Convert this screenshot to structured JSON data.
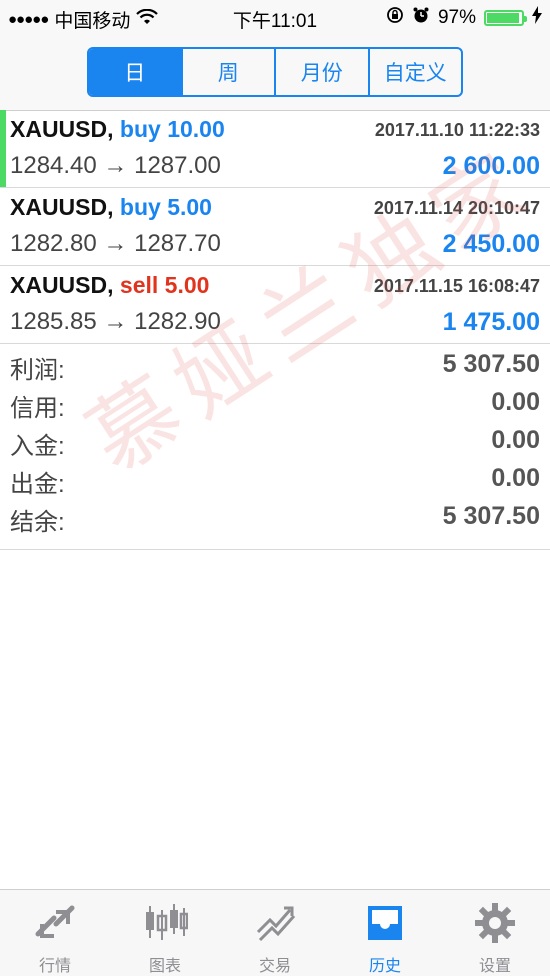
{
  "status_bar": {
    "carrier": "中国移动",
    "time": "下午11:01",
    "battery": "97%",
    "battery_level": 0.97
  },
  "segments": [
    {
      "label": "日",
      "active": true
    },
    {
      "label": "周",
      "active": false
    },
    {
      "label": "月份",
      "active": false
    },
    {
      "label": "自定义",
      "active": false
    }
  ],
  "trades": [
    {
      "symbol": "XAUUSD,",
      "side": "buy",
      "volume": "10.00",
      "time": "2017.11.10 11:22:33",
      "prices": "1284.40 → 1287.00",
      "profit": "2 600.00"
    },
    {
      "symbol": "XAUUSD,",
      "side": "buy",
      "volume": "5.00",
      "time": "2017.11.14 20:10:47",
      "prices": "1282.80 → 1287.70",
      "profit": "2 450.00"
    },
    {
      "symbol": "XAUUSD,",
      "side": "sell",
      "volume": "5.00",
      "time": "2017.11.15 16:08:47",
      "prices": "1285.85 → 1282.90",
      "profit": "1 475.00"
    }
  ],
  "summary": [
    {
      "label": "利润:",
      "value": "5 307.50"
    },
    {
      "label": "信用:",
      "value": "0.00"
    },
    {
      "label": "入金:",
      "value": "0.00"
    },
    {
      "label": "出金:",
      "value": "0.00"
    },
    {
      "label": "结余:",
      "value": "5 307.50"
    }
  ],
  "watermark": "慕娅兰独家",
  "tabs": [
    {
      "label": "行情",
      "icon": "quotes-icon",
      "active": false
    },
    {
      "label": "图表",
      "icon": "chart-icon",
      "active": false
    },
    {
      "label": "交易",
      "icon": "trade-icon",
      "active": false
    },
    {
      "label": "历史",
      "icon": "history-icon",
      "active": true
    },
    {
      "label": "设置",
      "icon": "settings-icon",
      "active": false
    }
  ],
  "colors": {
    "accent": "#1a84ef",
    "sell": "#e0341f",
    "highlight": "#4cd964"
  }
}
